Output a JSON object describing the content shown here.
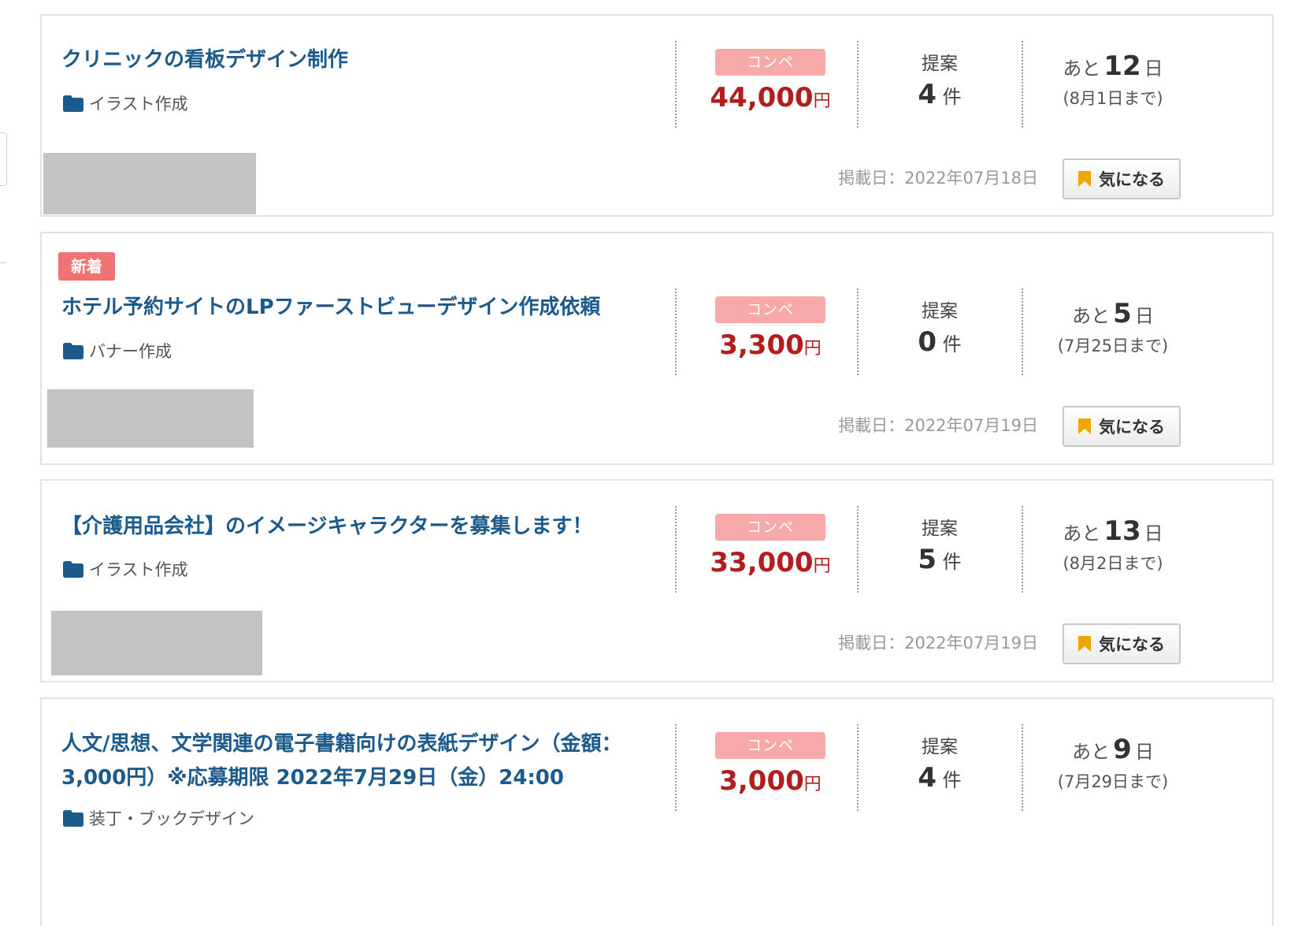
{
  "listings": [
    {
      "title": "クリニックの看板デザイン制作",
      "category": "イラスト作成",
      "type": "コンペ",
      "price": "44,000",
      "price_unit": "円",
      "proposals_label": "提案",
      "proposals_count": "4",
      "proposals_unit": "件",
      "days_prefix": "あと",
      "days_left": "12",
      "days_unit": "日",
      "deadline": "(8月1日まで)",
      "posted": "掲載日：2022年07月18日",
      "favorite_label": "気になる"
    },
    {
      "badge": "新着",
      "title": "ホテル予約サイトのLPファーストビューデザイン作成依頼",
      "category": "バナー作成",
      "type": "コンペ",
      "price": "3,300",
      "price_unit": "円",
      "proposals_label": "提案",
      "proposals_count": "0",
      "proposals_unit": "件",
      "days_prefix": "あと",
      "days_left": "5",
      "days_unit": "日",
      "deadline": "(7月25日まで)",
      "posted": "掲載日：2022年07月19日",
      "favorite_label": "気になる"
    },
    {
      "title": "【介護用品会社】のイメージキャラクターを募集します！",
      "category": "イラスト作成",
      "type": "コンペ",
      "price": "33,000",
      "price_unit": "円",
      "proposals_label": "提案",
      "proposals_count": "5",
      "proposals_unit": "件",
      "days_prefix": "あと",
      "days_left": "13",
      "days_unit": "日",
      "deadline": "(8月2日まで)",
      "posted": "掲載日：2022年07月19日",
      "favorite_label": "気になる"
    },
    {
      "title": "人文/思想、文学関連の電子書籍向けの表紙デザイン（金額：3,000円）※応募期限 2022年7月29日（金）24:00",
      "category": "装丁・ブックデザイン",
      "type": "コンペ",
      "price": "3,000",
      "price_unit": "円",
      "proposals_label": "提案",
      "proposals_count": "4",
      "proposals_unit": "件",
      "days_prefix": "あと",
      "days_left": "9",
      "days_unit": "日",
      "deadline": "(7月29日まで)"
    }
  ],
  "colors": {
    "title": "#1c5a8c",
    "price": "#b21d1d",
    "type_badge": "#f7a8a8",
    "new_badge": "#f07272",
    "bookmark": "#f0a500",
    "folder": "#1c5a8c"
  },
  "icons": {
    "category": "folder-icon",
    "favorite": "bookmark-icon"
  }
}
